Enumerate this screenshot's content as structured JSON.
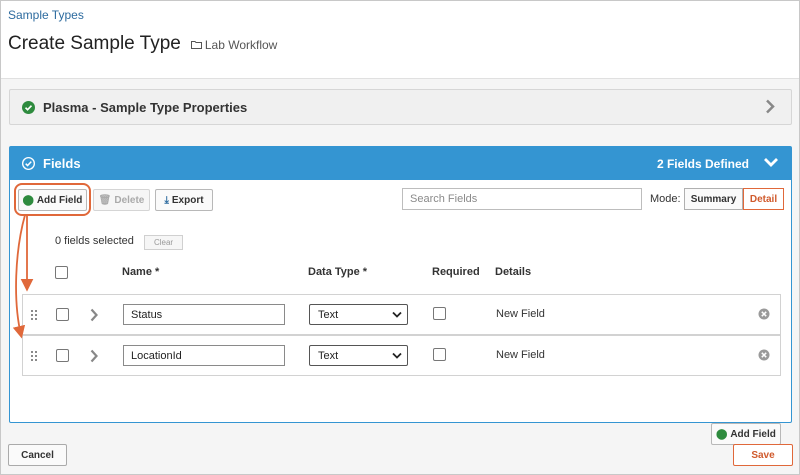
{
  "breadcrumb": "Sample Types",
  "page_title": "Create Sample Type",
  "folder": {
    "icon": "folder-icon",
    "label": "Lab Workflow"
  },
  "properties_panel": {
    "title": "Plasma - Sample Type Properties",
    "icon": "check-circle-icon"
  },
  "fields_panel": {
    "title": "Fields",
    "count_label": "2 Fields Defined",
    "toolbar": {
      "add_field_label": "Add Field",
      "delete_label": "Delete",
      "export_label": "Export",
      "search_placeholder": "Search Fields",
      "mode_label": "Mode:",
      "mode_summary": "Summary",
      "mode_detail": "Detail"
    },
    "selection": {
      "text": "0 fields selected",
      "clear_label": "Clear"
    },
    "columns": {
      "name": "Name *",
      "data_type": "Data Type *",
      "required": "Required",
      "details": "Details"
    },
    "rows": [
      {
        "name": "Status",
        "data_type": "Text",
        "required": false,
        "details": "New Field"
      },
      {
        "name": "LocationId",
        "data_type": "Text",
        "required": false,
        "details": "New Field"
      }
    ],
    "add_field_bottom_label": "Add Field"
  },
  "footer": {
    "cancel_label": "Cancel",
    "save_label": "Save"
  },
  "colors": {
    "accent_blue": "#3495d2",
    "highlight_orange": "#e0683a",
    "success_green": "#2e8b3e",
    "link_blue": "#2d6b9f"
  }
}
